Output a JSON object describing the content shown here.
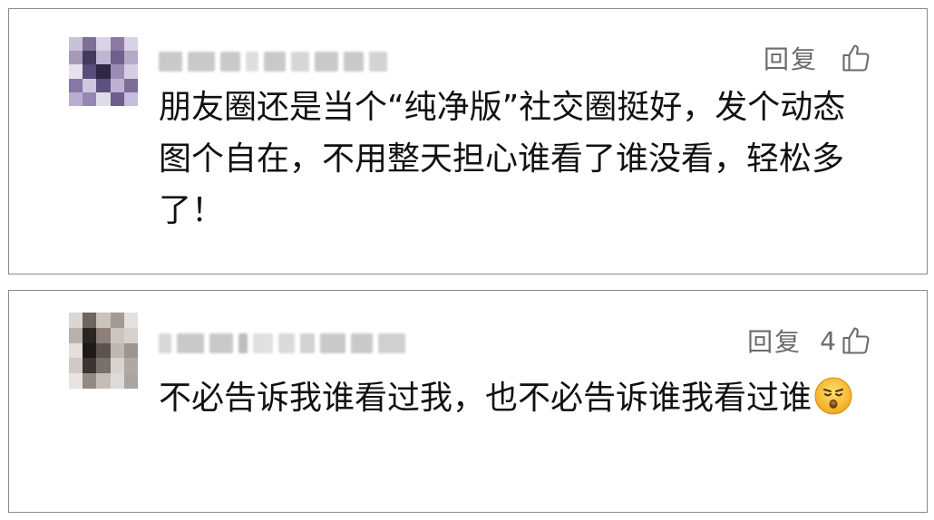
{
  "comments": [
    {
      "reply_label": "回复",
      "like_count": "",
      "text": "朋友圈还是当个“纯净版”社交圈挺好，发个动态图个自在，不用整天担心谁看了谁没看，轻松多了！",
      "icons": {
        "like": "thumbs-up-icon"
      }
    },
    {
      "reply_label": "回复",
      "like_count": "4",
      "text": "不必告诉我谁看过我，也不必告诉谁我看过谁",
      "emoji": "dizzy-face-emoji",
      "icons": {
        "like": "thumbs-up-icon"
      }
    }
  ]
}
